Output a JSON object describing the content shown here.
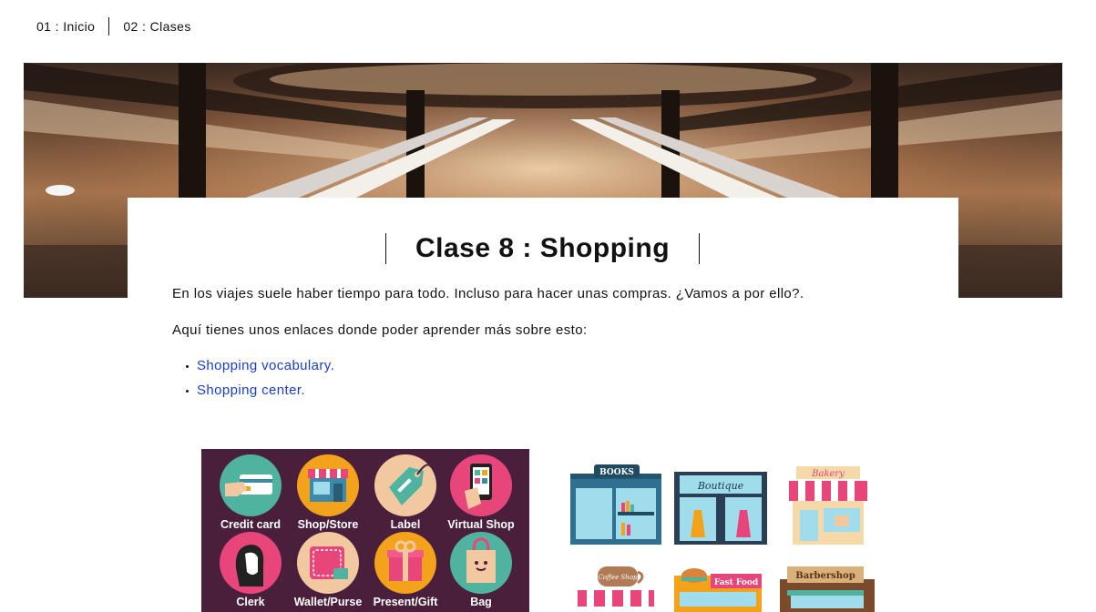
{
  "nav": {
    "items": [
      {
        "label": "01 : Inicio"
      },
      {
        "label": "02 : Clases"
      }
    ]
  },
  "page": {
    "title": "Clase 8 : Shopping",
    "intro": "En los viajes suele haber tiempo para todo. Incluso para hacer unas compras. ¿Vamos a por ello?.",
    "links_intro": "Aquí tienes unos enlaces donde poder aprender más sobre esto:",
    "links": [
      {
        "label": "Shopping vocabulary."
      },
      {
        "label": "Shopping center."
      }
    ]
  },
  "vocab_image": {
    "items": [
      {
        "label": "Credit card",
        "icon": "credit-card-icon",
        "color": "#4fb3a0"
      },
      {
        "label": "Shop/Store",
        "icon": "shop-store-icon",
        "color": "#f2a31b"
      },
      {
        "label": "Label",
        "icon": "label-tag-icon",
        "color": "#f2c8a0"
      },
      {
        "label": "Virtual Shop",
        "icon": "virtual-shop-icon",
        "color": "#e8467a"
      },
      {
        "label": "Clerk",
        "icon": "clerk-icon",
        "color": "#e8467a"
      },
      {
        "label": "Wallet/Purse",
        "icon": "wallet-icon",
        "color": "#f2c8a0"
      },
      {
        "label": "Present/Gift",
        "icon": "gift-icon",
        "color": "#f2a31b"
      },
      {
        "label": "Bag",
        "icon": "bag-icon",
        "color": "#4fb3a0"
      }
    ]
  },
  "stores_image": {
    "signs": [
      "BOOKS",
      "Boutique",
      "Bakery",
      "Coffee Shop",
      "Fast Food",
      "Barbershop"
    ]
  },
  "colors": {
    "link": "#1a3ecc",
    "vocab_bg": "#4a1f3c",
    "text": "#111111"
  }
}
